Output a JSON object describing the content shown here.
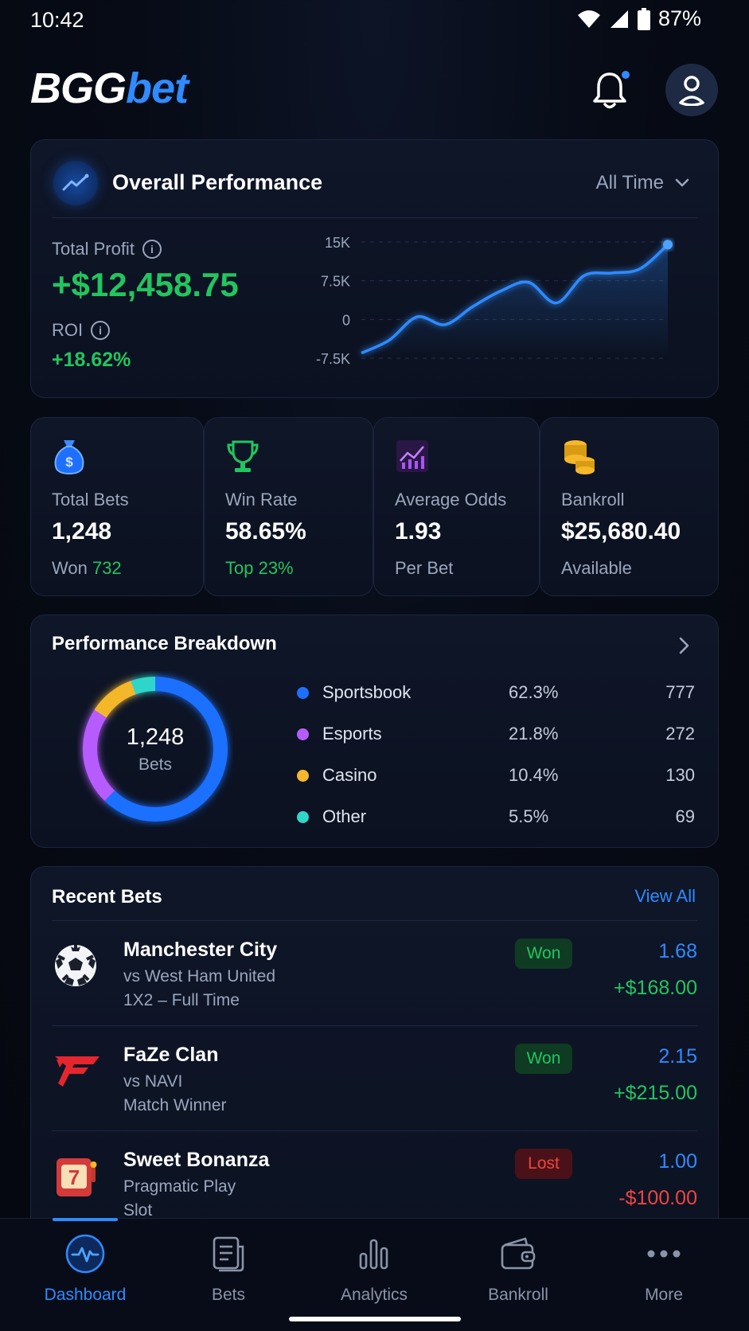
{
  "status_bar": {
    "time": "10:42",
    "battery": "87%"
  },
  "header": {
    "logo_part1": "BGG",
    "logo_part2": "bet"
  },
  "performance": {
    "title": "Overall Performance",
    "range": "All Time",
    "profit_label": "Total Profit",
    "profit_value": "+$12,458.75",
    "roi_label": "ROI",
    "roi_value": "+18.62%"
  },
  "chart_data": {
    "type": "line",
    "title": "",
    "xlabel": "",
    "ylabel": "",
    "y_ticks": [
      "15K",
      "7.5K",
      "0",
      "-7.5K"
    ],
    "ylim": [
      -7500,
      15000
    ],
    "grid": true,
    "series": [
      {
        "values": [
          -6500,
          -4000,
          500,
          -1000,
          2500,
          5500,
          7200,
          3200,
          8500,
          9000,
          9800,
          14500
        ]
      }
    ],
    "colors": {
      "line": "#2f8bff"
    }
  },
  "stats": [
    {
      "label": "Total Bets",
      "value": "1,248",
      "sub_prefix": "Won ",
      "sub_highlight": "732",
      "icon": "money-bag-icon",
      "color": "#2f8bff"
    },
    {
      "label": "Win Rate",
      "value": "58.65%",
      "sub_prefix": "",
      "sub_highlight": "Top 23%",
      "icon": "trophy-icon",
      "color": "#22c55e"
    },
    {
      "label": "Average Odds",
      "value": "1.93",
      "sub_prefix": "Per Bet",
      "sub_highlight": "",
      "icon": "chart-growth-icon",
      "color": "#a855f7"
    },
    {
      "label": "Bankroll",
      "value": "$25,680.40",
      "sub_prefix": "Available",
      "sub_highlight": "",
      "icon": "coins-icon",
      "color": "#f5b72b"
    }
  ],
  "breakdown": {
    "title": "Performance Breakdown",
    "center_value": "1,248",
    "center_label": "Bets",
    "items": [
      {
        "name": "Sportsbook",
        "pct": "62.3%",
        "count": "777",
        "color": "#1f6fff"
      },
      {
        "name": "Esports",
        "pct": "21.8%",
        "count": "272",
        "color": "#b65cff"
      },
      {
        "name": "Casino",
        "pct": "10.4%",
        "count": "130",
        "color": "#f5b72b"
      },
      {
        "name": "Other",
        "pct": "5.5%",
        "count": "69",
        "color": "#2fd6c9"
      }
    ],
    "values": [
      62.3,
      21.8,
      10.4,
      5.5
    ]
  },
  "recent": {
    "title": "Recent Bets",
    "view_all": "View All",
    "bets": [
      {
        "title": "Manchester City",
        "line1": "vs West Ham United",
        "line2": "1X2 – Full Time",
        "status": "Won",
        "odds": "1.68",
        "amount": "+$168.00"
      },
      {
        "title": "FaZe Clan",
        "line1": "vs NAVI",
        "line2": "Match Winner",
        "status": "Won",
        "odds": "2.15",
        "amount": "+$215.00"
      },
      {
        "title": "Sweet Bonanza",
        "line1": "Pragmatic Play",
        "line2": "Slot",
        "status": "Lost",
        "odds": "1.00",
        "amount": "-$100.00"
      }
    ]
  },
  "nav": [
    {
      "label": "Dashboard"
    },
    {
      "label": "Bets"
    },
    {
      "label": "Analytics"
    },
    {
      "label": "Bankroll"
    },
    {
      "label": "More"
    }
  ]
}
